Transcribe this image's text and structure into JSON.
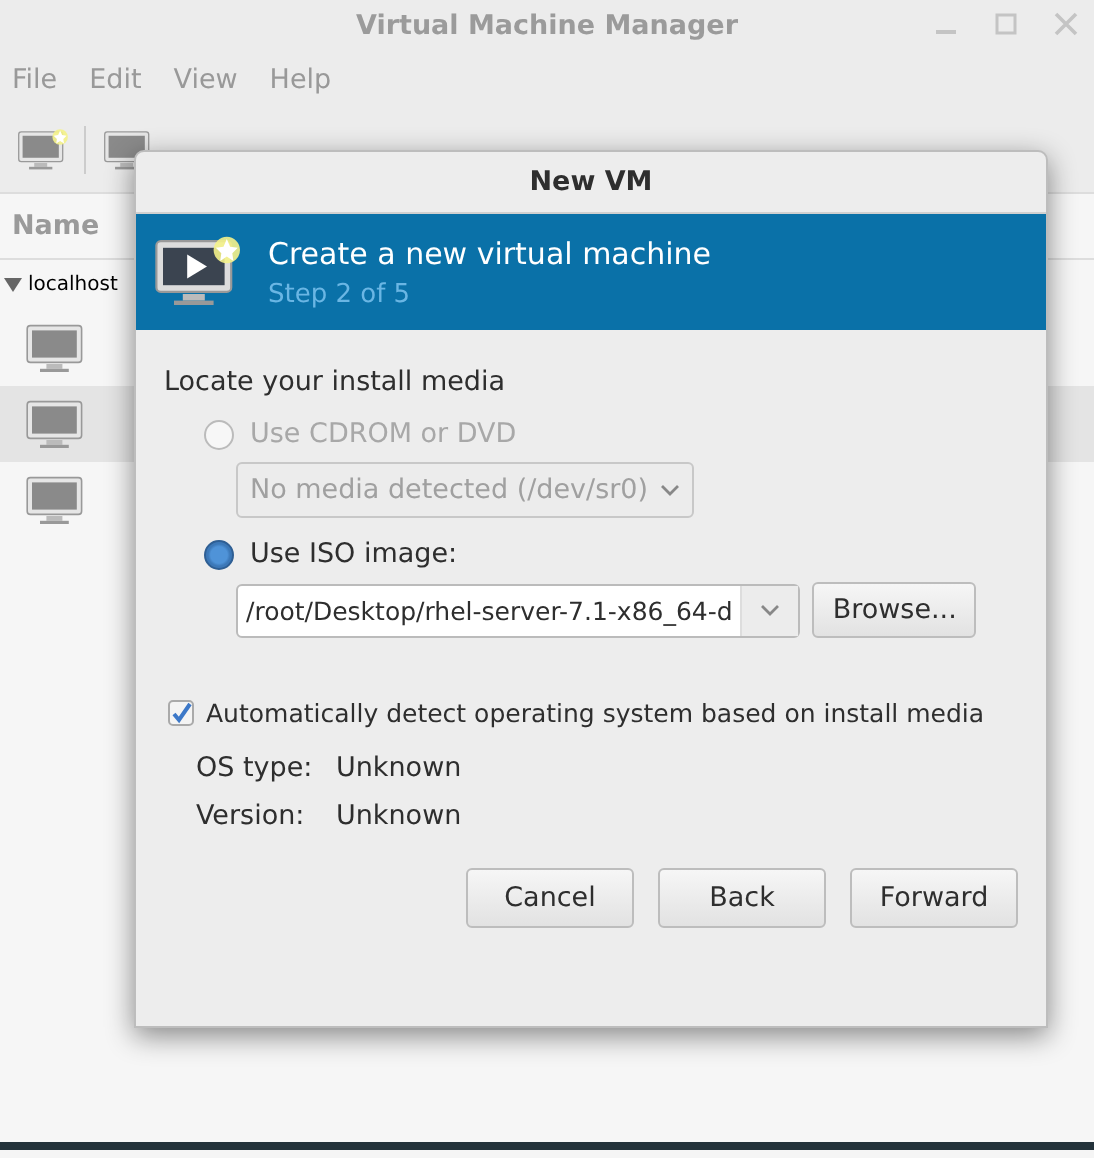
{
  "app_window": {
    "title": "Virtual Machine Manager",
    "menu": [
      "File",
      "Edit",
      "View",
      "Help"
    ],
    "list": {
      "column": "Name",
      "host": {
        "label": "localhost",
        "expanded": true
      },
      "vms": [
        {
          "selected": false
        },
        {
          "selected": true
        },
        {
          "selected": false
        }
      ]
    }
  },
  "dialog": {
    "title": "New VM",
    "banner": {
      "heading": "Create a new virtual machine",
      "step": "Step 2 of 5"
    },
    "section_label": "Locate your install media",
    "options": [
      {
        "label": "Use CDROM or DVD",
        "selected": false,
        "disabled": true,
        "kind": "combo",
        "value": "No media detected (/dev/sr0)"
      },
      {
        "label": "Use ISO image:",
        "selected": true,
        "disabled": false,
        "kind": "combo-entry",
        "value": "/root/Desktop/rhel-server-7.1-x86_64-d",
        "button": "Browse..."
      }
    ],
    "auto_detect": {
      "label": "Automatically detect operating system based on install media",
      "checked": true
    },
    "info": [
      {
        "label": "OS type:",
        "value": "Unknown"
      },
      {
        "label": "Version:",
        "value": "Unknown"
      }
    ],
    "buttons": [
      "Cancel",
      "Back",
      "Forward"
    ]
  }
}
